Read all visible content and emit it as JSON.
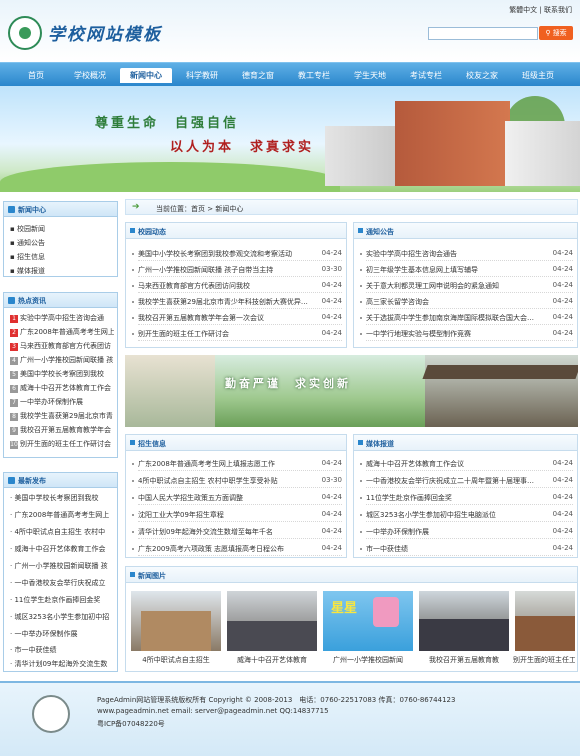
{
  "header": {
    "site_title": "学校网站模板",
    "top_links": "繁體中文 | 联系我们",
    "search_label": "搜索"
  },
  "nav": [
    "首页",
    "学校概况",
    "新闻中心",
    "科学教研",
    "德育之窗",
    "教工专栏",
    "学生天地",
    "考试专栏",
    "校友之家",
    "班级主页"
  ],
  "banner": {
    "slogan1": "尊重生命　自强自信",
    "slogan2": "以人为本　求真求实"
  },
  "sidebar": {
    "news_center": {
      "title": "新闻中心",
      "items": [
        "校园新闻",
        "通知公告",
        "招生信息",
        "媒体报道"
      ]
    },
    "hot": {
      "title": "热点资讯",
      "items": [
        "实验中学高中招生咨询会通",
        "广东2008年普通高考考生网上",
        "马来西亚教育部官方代表团访",
        "广州一小学推校园新闻联播 孩",
        "美国中学校长考察团到我校",
        "威海十中召开艺体教育工作会",
        "一中举办环保制作展",
        "我校学生喜获第29届北京市青",
        "我校召开第五届教育教学年会",
        "别开生面的班主任工作研讨会"
      ]
    },
    "latest": {
      "title": "最新发布",
      "items": [
        "美国中学校长考察团到我校",
        "广东2008年普通高考考生网上",
        "4所中职试点自主招生 农村中",
        "威海十中召开艺体教育工作会",
        "广州一小学推校园新闻联播 孩",
        "一中香港校友会举行庆祝成立",
        "11位学生赴京作画捧回金奖",
        "城区3253名小学生参加初中招",
        "一中举办环保制作展",
        "市一中获佳绩",
        "清华计划09年起海外交流生数"
      ]
    }
  },
  "crumb": "当前位置：首页 > 新闻中心",
  "school_news": {
    "title": "校园动态",
    "rows": [
      [
        "美国中小学校长考察团到我校参观交流和考察活动",
        "04-24"
      ],
      [
        "广州一小学推校园新闻联播 孩子自带当主持",
        "03-30"
      ],
      [
        "马来西亚教育部官方代表团访问我校",
        "04-24"
      ],
      [
        "我校学生喜获第29届北京市青少年科技创新大赛优异…",
        "04-24"
      ],
      [
        "我校召开第五届教育教学年会第一次会议",
        "04-24"
      ],
      [
        "别开生面的班主任工作研讨会",
        "04-24"
      ]
    ]
  },
  "notices": {
    "title": "通知公告",
    "rows": [
      [
        "实验中学高中招生咨询会通告",
        "04-24"
      ],
      [
        "初三年级学生基本信息网上填写辅导",
        "04-24"
      ],
      [
        "关于意大利都灵理工网申说明会的紧急通知",
        "04-24"
      ],
      [
        "高三家长留学咨询会",
        "04-24"
      ],
      [
        "关于选拔高中学生参加南京海岸国际模拟联合国大会…",
        "04-24"
      ],
      [
        "一中学行地理实验与模型制作竞赛",
        "04-24"
      ]
    ]
  },
  "mid_banner": {
    "slogan": "勤奋严谨　求实创新"
  },
  "admission": {
    "title": "招生信息",
    "rows": [
      [
        "广东2008年普通高考考生网上填报志愿工作",
        "04-24"
      ],
      [
        "4所中职试点自主招生 农村中职学生享受补贴",
        "03-30"
      ],
      [
        "中国人民大学招生政策五方面调整",
        "04-24"
      ],
      [
        "沈阳工业大学09年招生章程",
        "04-24"
      ],
      [
        "清华计划09年起海外交流生数增至每年千名",
        "04-24"
      ],
      [
        "广东2009高考六项政策 志愿填报高考日程公布",
        "04-24"
      ]
    ]
  },
  "media": {
    "title": "媒体报道",
    "rows": [
      [
        "威海十中召开艺体教育工作会议",
        "04-24"
      ],
      [
        "一中香港校友会举行庆祝成立二十周年暨第十届理事…",
        "04-24"
      ],
      [
        "11位学生赴京作画捧回金奖",
        "04-24"
      ],
      [
        "城区3253名小学生参加初中招生电脑派位",
        "04-24"
      ],
      [
        "一中举办环保制作展",
        "04-24"
      ],
      [
        "市一中获佳绩",
        "04-24"
      ]
    ]
  },
  "photos": {
    "title": "新闻图片",
    "captions": [
      "4所中职试点自主招生",
      "威海十中召开艺体教育",
      "广州一小学推校园新闻",
      "我校召开第五届教育教",
      "别开生面的班主任工"
    ]
  },
  "footer": {
    "line1": "PageAdmin网站管理系统版权所有 Copyright © 2008-2013　电话：0760-22517083 传真：0760-86744123",
    "line2": "www.pageadmin.net email: server@pageadmin.net QQ:14837715",
    "line3": "粤ICP备07048220号"
  }
}
